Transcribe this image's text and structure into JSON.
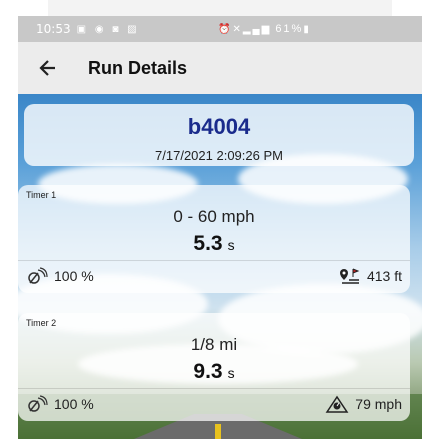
{
  "status_bar": {
    "time": "10:53",
    "battery": "61%",
    "icons": [
      "message-icon",
      "facebook-icon",
      "app-icon",
      "image-icon",
      "alarm-icon",
      "mute-icon",
      "signal-icon",
      "wifi-icon",
      "battery-icon"
    ]
  },
  "app_bar": {
    "title": "Run Details",
    "back_icon": "arrow-left-icon"
  },
  "run": {
    "id": "b4004",
    "datetime": "7/17/2021 2:09:26 PM"
  },
  "timers": [
    {
      "label": "Timer 1",
      "range": "0  -  60 mph",
      "value": "5.3",
      "unit": "s",
      "left_stat": "100 %",
      "right_stat": "413 ft",
      "left_icon": "gps-signal-icon",
      "right_icon": "distance-icon"
    },
    {
      "label": "Timer 2",
      "range": "1/8 mi",
      "value": "9.3",
      "unit": "s",
      "left_stat": "100 %",
      "right_stat": "79 mph",
      "left_icon": "gps-signal-icon",
      "right_icon": "speed-trap-icon"
    }
  ],
  "colors": {
    "run_id": "#1a2b8c",
    "status_bar": "#c8c8c8",
    "app_bar": "#ececec"
  }
}
